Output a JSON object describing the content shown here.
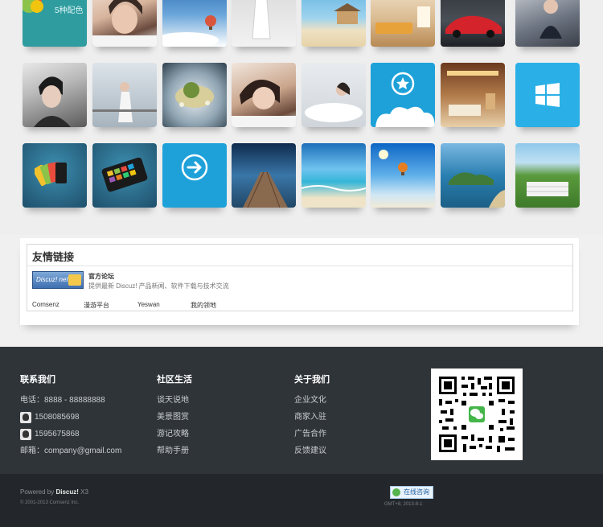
{
  "colors": {
    "tile_teal": "#2f9c9f",
    "tile_blue": "#1ea1d9",
    "tile_win": "#2ab0e6",
    "footer_bg": "#2f3439",
    "bottom_bg": "#23272b"
  },
  "tiles": [
    {
      "name": "color-scheme-tile",
      "caption": "5种配色",
      "kind": "color-scheme"
    },
    {
      "name": "photo-woman-portrait",
      "caption": "",
      "kind": "photo"
    },
    {
      "name": "photo-hot-air-balloon-sky",
      "caption": "",
      "kind": "photo"
    },
    {
      "name": "photo-woman-white-dress",
      "caption": "",
      "kind": "photo"
    },
    {
      "name": "photo-beach-house",
      "caption": "",
      "kind": "photo"
    },
    {
      "name": "photo-living-room",
      "caption": "",
      "kind": "photo"
    },
    {
      "name": "photo-red-sports-car",
      "caption": "",
      "kind": "photo"
    },
    {
      "name": "photo-woman-dark",
      "caption": "",
      "kind": "photo"
    },
    {
      "name": "photo-young-man",
      "caption": "",
      "kind": "photo"
    },
    {
      "name": "photo-woman-balcony",
      "caption": "",
      "kind": "photo"
    },
    {
      "name": "photo-food-plate",
      "caption": "",
      "kind": "photo"
    },
    {
      "name": "photo-woman-smiling",
      "caption": "",
      "kind": "photo"
    },
    {
      "name": "photo-woman-bed",
      "caption": "",
      "kind": "photo"
    },
    {
      "name": "star-cloud-tile",
      "caption": "",
      "kind": "star-cloud",
      "icon": "star-icon"
    },
    {
      "name": "photo-bedroom-interior",
      "caption": "",
      "kind": "photo"
    },
    {
      "name": "windows-tile",
      "caption": "",
      "kind": "windows",
      "icon": "windows-logo-icon"
    },
    {
      "name": "phones-tile",
      "caption": "",
      "kind": "phones",
      "icon": "colorful-phones-icon"
    },
    {
      "name": "smartphone-tile",
      "caption": "",
      "kind": "smartphone",
      "icon": "smartphone-icon"
    },
    {
      "name": "arrow-tile",
      "caption": "",
      "kind": "arrow",
      "icon": "arrow-right-circle-icon"
    },
    {
      "name": "photo-wooden-pier",
      "caption": "",
      "kind": "photo"
    },
    {
      "name": "photo-tropical-sea",
      "caption": "",
      "kind": "photo"
    },
    {
      "name": "photo-balloon-beach",
      "caption": "",
      "kind": "photo"
    },
    {
      "name": "photo-island-bay",
      "caption": "",
      "kind": "photo"
    },
    {
      "name": "photo-wedding-lawn",
      "caption": "",
      "kind": "photo"
    }
  ],
  "friend_links": {
    "title": "友情链接",
    "featured": {
      "logo_text": "Discuz! net",
      "name": "官方论坛",
      "desc": "提供最新 Discuz! 产品新闻、软件下载与技术交流"
    },
    "items": [
      "Comsenz",
      "漫游平台",
      "Yeswan",
      "我的领地"
    ]
  },
  "footer": {
    "contact": {
      "title": "联系我们",
      "phone": "电话：8888 - 88888888",
      "qq1": "1508085698",
      "qq2": "1595675868",
      "email": "邮箱：company@gmail.com"
    },
    "community": {
      "title": "社区生活",
      "items": [
        "谈天说地",
        "美景图赏",
        "游记攻略",
        "帮助手册"
      ]
    },
    "about": {
      "title": "关于我们",
      "items": [
        "企业文化",
        "商家入驻",
        "广告合作",
        "反馈建议"
      ]
    }
  },
  "bottom": {
    "powered_prefix": "Powered by",
    "powered_brand": "Discuz!",
    "powered_ver": "X3",
    "copyright": "© 2001-2013 Comsenz Inc.",
    "consult_label": "在线咨询",
    "gmt": "GMT+8, 2013-8-1"
  }
}
